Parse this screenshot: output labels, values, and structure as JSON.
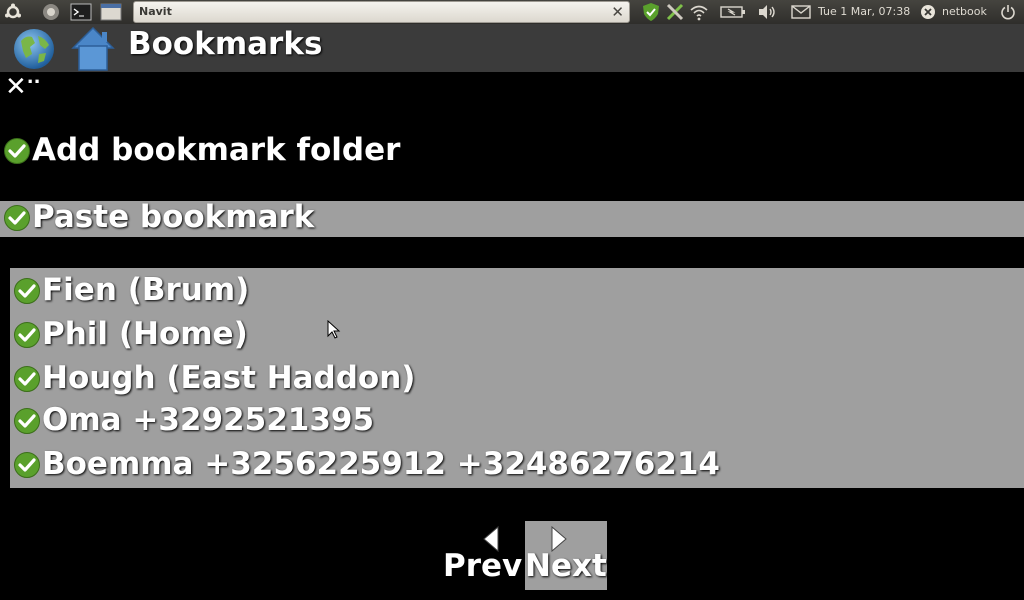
{
  "panel": {
    "task_title": "Navit",
    "clock": "Tue  1 Mar, 07:38",
    "user": "netbook"
  },
  "header": {
    "title": "Bookmarks"
  },
  "menu": {
    "close_label": "..",
    "add_folder": "Add bookmark folder",
    "paste": "Paste bookmark"
  },
  "bookmarks": [
    "Fien (Brum)",
    "Phil (Home)",
    "Hough (East Haddon)",
    "Oma +3292521395",
    "Boemma +3256225912 +32486276214"
  ],
  "nav": {
    "prev": "Prev",
    "next": "Next"
  },
  "colors": {
    "selection": "#9f9f9f",
    "check_green": "#5aa02c",
    "header_bg": "#3b3b3b"
  }
}
